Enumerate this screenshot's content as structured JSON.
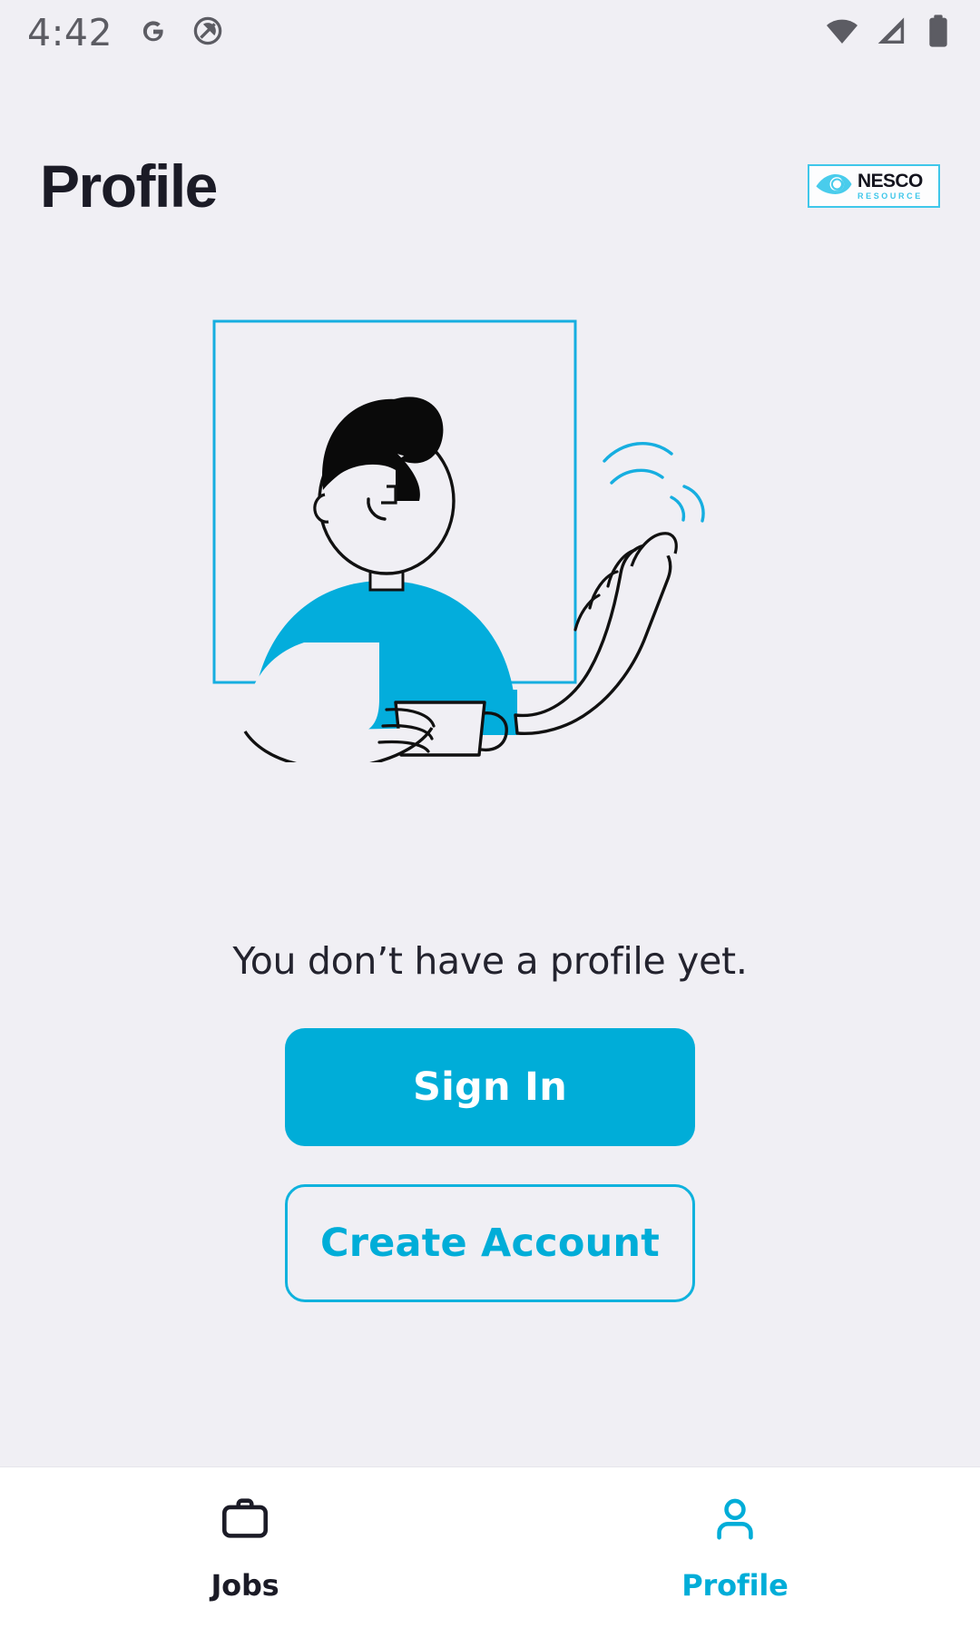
{
  "status_bar": {
    "time": "4:42",
    "left_icons": [
      "google-g-icon",
      "circle-slash-icon"
    ],
    "right_icons": [
      "wifi-icon",
      "cellular-signal-icon",
      "battery-icon"
    ]
  },
  "header": {
    "title": "Profile",
    "logo": {
      "name": "NESCO",
      "subtitle": "RESOURCE",
      "mark": "eye-wave-icon"
    }
  },
  "illustration": {
    "name": "waving-person-illustration",
    "description": "Person with black quiff hair waving and holding a mug inside a cyan square frame"
  },
  "main": {
    "empty_message": "You don’t have a profile yet.",
    "buttons": [
      {
        "label": "Sign In",
        "style": "filled"
      },
      {
        "label": "Create Account",
        "style": "outlined"
      }
    ]
  },
  "bottom_nav": {
    "items": [
      {
        "label": "Jobs",
        "icon": "briefcase-icon",
        "active": false
      },
      {
        "label": "Profile",
        "icon": "person-icon",
        "active": true
      }
    ]
  },
  "colors": {
    "accent": "#00ADD8",
    "accent_light": "#3FC7EA",
    "background": "#F0EFF4",
    "text_dark": "#1B1B26",
    "nav_background": "#FFFFFF"
  }
}
